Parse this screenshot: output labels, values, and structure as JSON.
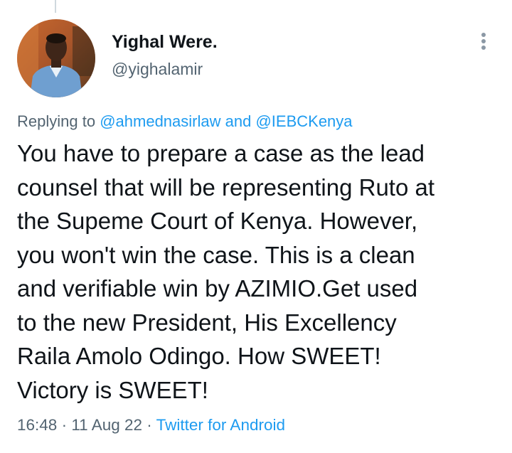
{
  "author": {
    "display_name": "Yighal Were.",
    "handle": "@yighalamir"
  },
  "reply": {
    "prefix": "Replying to",
    "mention_1": "@ahmednasirlaw",
    "conjunction": "and",
    "mention_2": "@IEBCKenya"
  },
  "tweet": {
    "line_1": "You have to prepare a case as the lead",
    "line_2": "counsel that will be representing Ruto at",
    "line_3": "the Supeme Court of Kenya. However,",
    "line_4": "you won't win the case. This is a clean",
    "line_5": "and verifiable win by AZIMIO.Get used",
    "line_6": "to the new President, His Excellency",
    "line_7": "Raila Amolo Odingo. How SWEET!",
    "line_8": "Victory is SWEET!"
  },
  "meta": {
    "time": "16:48",
    "separator": "·",
    "date": "11 Aug 22",
    "source": "Twitter for Android"
  },
  "icons": {
    "more": "more-vertical-icon"
  },
  "colors": {
    "link": "#1d9bf0",
    "text": "#0f1419",
    "secondary": "#536471"
  }
}
